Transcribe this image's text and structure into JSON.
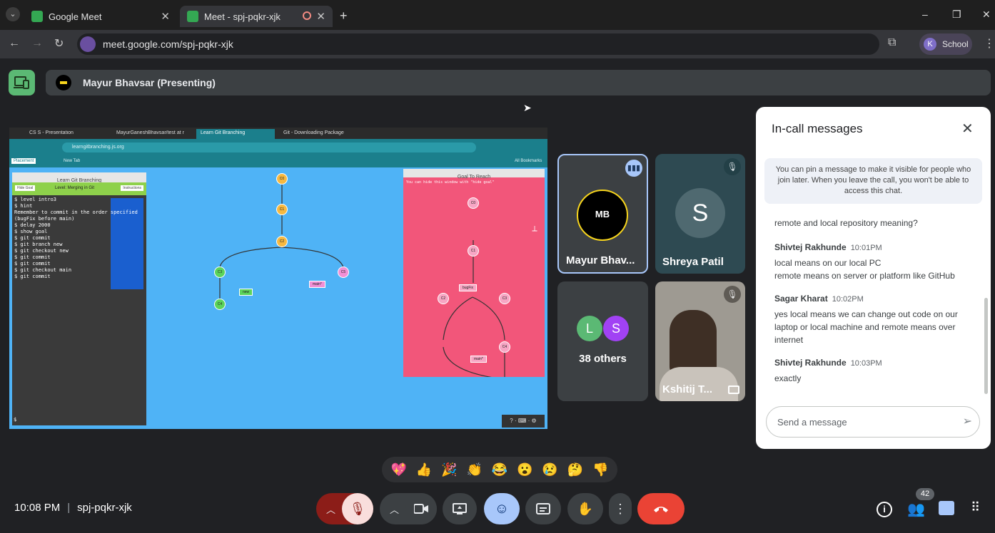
{
  "browser": {
    "tabs": [
      {
        "title": "Google Meet",
        "favicon_color": "#34a853"
      },
      {
        "title": "Meet - spj-pqkr-xjk",
        "favicon_color": "#34a853"
      }
    ],
    "new_tab_symbol": "+",
    "url": "meet.google.com/spj-pqkr-xjk",
    "profile_initial": "K",
    "profile_label": "School",
    "window_controls": [
      "–",
      "❐",
      "✕"
    ]
  },
  "meeting": {
    "presenter_label": "Mayur Bhavsar (Presenting)",
    "time": "10:08 PM",
    "separator": "|",
    "code": "spj-pqkr-xjk",
    "participant_count": "42"
  },
  "shared_screen": {
    "tabs": [
      "CS S - Presentation",
      "MayurGaneshBhavsar/test at m",
      "Learn Git Branching",
      "Git - Downloading Package"
    ],
    "url": "learngitbranching.js.org",
    "bookmarks": [
      "Placement",
      "New Tab"
    ],
    "all_bookmarks": "All Bookmarks",
    "left_panel_title": "Learn Git Branching",
    "level_label": "Level: Merging in Git",
    "hide_goal": "Hide Goal",
    "instructions": "Instructions",
    "terminal_lines": [
      "$ level intro3",
      "$ hint",
      "Remember to commit in the order specified",
      "(bugFix before main)",
      "$ delay 2000",
      "$ show goal",
      "$ git commit",
      "$ git branch new",
      "$ git checkout new",
      "$ git commit",
      "$ git commit",
      "$ git checkout main",
      "$ git commit"
    ],
    "prompt": "$",
    "goal_title": "Goal To Reach",
    "goal_hint": "You can hide this window with \"hide goal\"",
    "main_graph_nodes": [
      "C0",
      "C1",
      "C2",
      "C3",
      "C4",
      "C5"
    ],
    "main_branch_labels": [
      "new",
      "main*"
    ],
    "goal_nodes": [
      "C0",
      "C1",
      "C2",
      "C3",
      "C4"
    ],
    "goal_branch_labels": [
      "bugFix",
      "main*"
    ],
    "footer": "? · ⌨ · ⚙"
  },
  "participants": [
    {
      "name": "Mayur Bhav...",
      "avatar_text": "MB",
      "speaking": true
    },
    {
      "name": "Shreya Patil",
      "avatar_text": "S",
      "muted": true
    },
    {
      "name": "38 others",
      "avatars": [
        "L",
        "S"
      ]
    },
    {
      "name": "Kshitij T...",
      "muted": true
    }
  ],
  "chat": {
    "title": "In-call messages",
    "pin_info": "You can pin a message to make it visible for people who join later. When you leave the call, you won't be able to access this chat.",
    "messages": [
      {
        "sender": "",
        "time": "",
        "lines": [
          "remote and local repository meaning?"
        ]
      },
      {
        "sender": "Shivtej Rakhunde",
        "time": "10:01PM",
        "lines": [
          "local means on our local PC",
          "remote means on server or platform like GitHub"
        ]
      },
      {
        "sender": "Sagar Kharat",
        "time": "10:02PM",
        "lines": [
          "yes local means we can change out code on our",
          "laptop or local machine and remote means over",
          "internet"
        ]
      },
      {
        "sender": "Shivtej Rakhunde",
        "time": "10:03PM",
        "lines": [
          "exactly"
        ]
      }
    ],
    "input_placeholder": "Send a message"
  },
  "reactions": [
    "💖",
    "👍",
    "🎉",
    "👏",
    "😂",
    "😮",
    "😢",
    "🤔",
    "👎"
  ],
  "colors": {
    "meet_bg": "#202124",
    "end_call": "#ea4335",
    "active_control": "#a8c7fa",
    "mic_off": "#f9dedc",
    "stage_bg": "#4fb3f6",
    "goal_bg": "#f2567a"
  }
}
